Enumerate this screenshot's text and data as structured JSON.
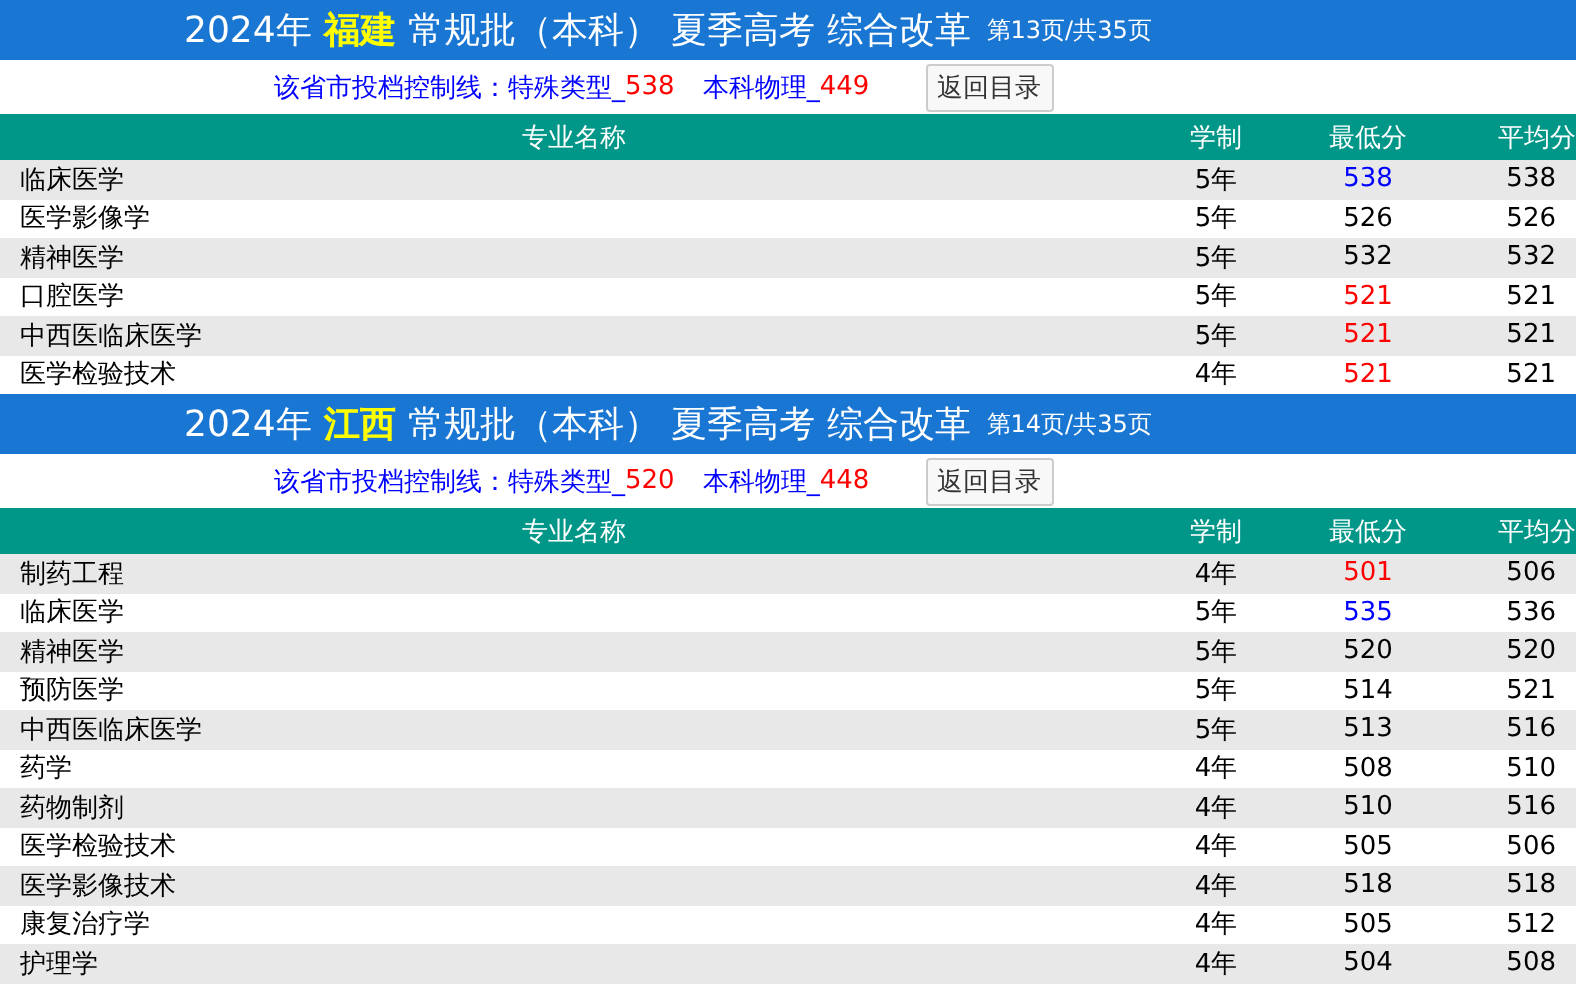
{
  "sections": [
    {
      "title": {
        "year": "2024年",
        "province": "福建",
        "batch": "常规批（本科） 夏季高考 综合改革",
        "page": "第13页/共35页"
      },
      "control_line": {
        "label": "该省市投档控制线：",
        "items": [
          {
            "name": "特殊类型_",
            "value": "538"
          },
          {
            "name": "本科物理_",
            "value": "449"
          }
        ]
      },
      "back_button": "返回目录",
      "columns": [
        "专业名称",
        "学制",
        "最低分",
        "平均分"
      ],
      "rows": [
        {
          "major": "临床医学",
          "years": "5年",
          "min": "538",
          "avg": "538",
          "color": "#0000ff"
        },
        {
          "major": "医学影像学",
          "years": "5年",
          "min": "526",
          "avg": "526",
          "color": "#000000"
        },
        {
          "major": "精神医学",
          "years": "5年",
          "min": "532",
          "avg": "532",
          "color": "#000000"
        },
        {
          "major": "口腔医学",
          "years": "5年",
          "min": "521",
          "avg": "521",
          "color": "#ff0000"
        },
        {
          "major": "中西医临床医学",
          "years": "5年",
          "min": "521",
          "avg": "521",
          "color": "#ff0000"
        },
        {
          "major": "医学检验技术",
          "years": "4年",
          "min": "521",
          "avg": "521",
          "color": "#ff0000"
        }
      ]
    },
    {
      "title": {
        "year": "2024年",
        "province": "江西",
        "batch": "常规批（本科） 夏季高考 综合改革",
        "page": "第14页/共35页"
      },
      "control_line": {
        "label": "该省市投档控制线：",
        "items": [
          {
            "name": "特殊类型_",
            "value": "520"
          },
          {
            "name": "本科物理_",
            "value": "448"
          }
        ]
      },
      "back_button": "返回目录",
      "columns": [
        "专业名称",
        "学制",
        "最低分",
        "平均分"
      ],
      "rows": [
        {
          "major": "制药工程",
          "years": "4年",
          "min": "501",
          "avg": "506",
          "color": "#ff0000"
        },
        {
          "major": "临床医学",
          "years": "5年",
          "min": "535",
          "avg": "536",
          "color": "#0000ff"
        },
        {
          "major": "精神医学",
          "years": "5年",
          "min": "520",
          "avg": "520",
          "color": "#000000"
        },
        {
          "major": "预防医学",
          "years": "5年",
          "min": "514",
          "avg": "521",
          "color": "#000000"
        },
        {
          "major": "中西医临床医学",
          "years": "5年",
          "min": "513",
          "avg": "516",
          "color": "#000000"
        },
        {
          "major": "药学",
          "years": "4年",
          "min": "508",
          "avg": "510",
          "color": "#000000"
        },
        {
          "major": "药物制剂",
          "years": "4年",
          "min": "510",
          "avg": "516",
          "color": "#000000"
        },
        {
          "major": "医学检验技术",
          "years": "4年",
          "min": "505",
          "avg": "506",
          "color": "#000000"
        },
        {
          "major": "医学影像技术",
          "years": "4年",
          "min": "518",
          "avg": "518",
          "color": "#000000"
        },
        {
          "major": "康复治疗学",
          "years": "4年",
          "min": "505",
          "avg": "512",
          "color": "#000000"
        },
        {
          "major": "护理学",
          "years": "4年",
          "min": "504",
          "avg": "508",
          "color": "#000000"
        }
      ]
    }
  ]
}
